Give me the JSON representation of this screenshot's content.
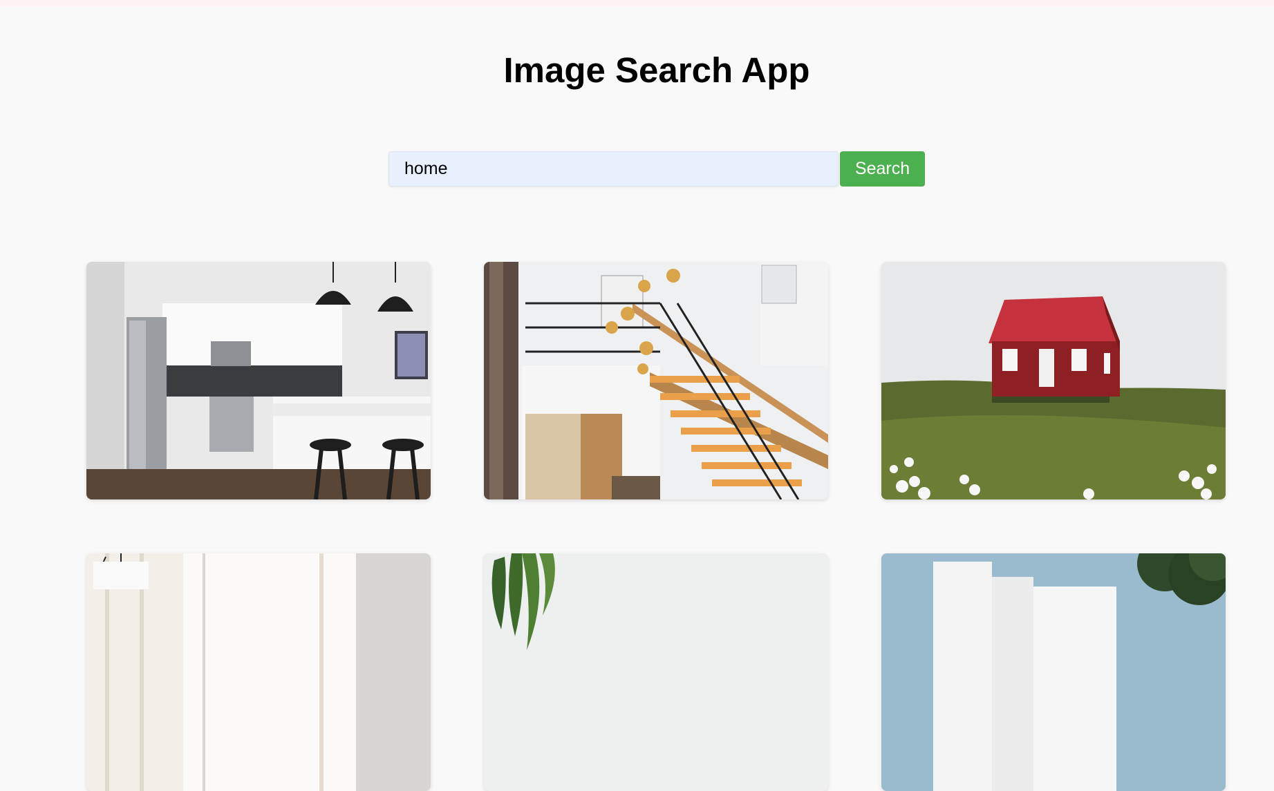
{
  "app": {
    "title": "Image Search App"
  },
  "search": {
    "value": "home",
    "button_label": "Search"
  },
  "results": [
    {
      "subject": "modern white kitchen with pendant lights and bar stools"
    },
    {
      "subject": "staircase with wooden handrail and hanging gold lights"
    },
    {
      "subject": "red cabin house on a green hill"
    },
    {
      "subject": "bright living room with white curtains and lamp"
    },
    {
      "subject": "green plant leaves against a white wall"
    },
    {
      "subject": "white modern building under blue sky with trees"
    }
  ],
  "colors": {
    "background": "#f9f9f9",
    "search_button": "#4caf50",
    "input_background": "#e8f0fe"
  }
}
